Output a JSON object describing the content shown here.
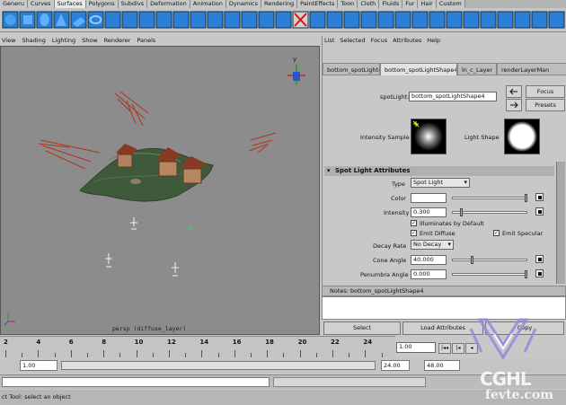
{
  "shelf_tabs": [
    "Generu",
    "Curves",
    "Surfaces",
    "Polygons",
    "Subdivs",
    "Deformation",
    "Animation",
    "Dynamics",
    "Rendering",
    "PaintEffects",
    "Toon",
    "Cloth",
    "Fluids",
    "Fur",
    "Hair",
    "Custom"
  ],
  "shelf_active_index": 2,
  "viewport": {
    "menu": [
      "View",
      "Shading",
      "Lighting",
      "Show",
      "Renderer",
      "Panels"
    ],
    "camera_label": "persp (diffuse_layer)"
  },
  "attribute_editor": {
    "menu": [
      "List",
      "Selected",
      "Focus",
      "Attributes",
      "Help"
    ],
    "tabs": [
      "bottom_spotLight4",
      "bottom_spotLightShape4",
      "ln_c_Layer",
      "renderLayerMan"
    ],
    "active_tab_index": 1,
    "node_label": "spotLight:",
    "node_value": "bottom_spotLightShape4",
    "focus_button": "Focus",
    "presets_button": "Presets",
    "intensity_sample_label": "Intensity Sample",
    "light_shape_label": "Light Shape",
    "section_title": "Spot Light Attributes",
    "type_label": "Type",
    "type_value": "Spot Light",
    "color_label": "Color",
    "intensity_label": "Intensity",
    "intensity_value": "0.300",
    "illuminates_label": "Illuminates by Default",
    "emit_diffuse_label": "Emit Diffuse",
    "emit_specular_label": "Emit Specular",
    "decay_label": "Decay Rate",
    "decay_value": "No Decay",
    "cone_label": "Cone Angle",
    "cone_value": "40.000",
    "penumbra_label": "Penumbra Angle",
    "penumbra_value": "0.000"
  },
  "notes": {
    "title": "Notes: bottom_spotLightShape4"
  },
  "bottom_buttons": {
    "select": "Select",
    "load_attributes": "Load Attributes",
    "copy_tab": "Copy"
  },
  "timeline": {
    "ticks": [
      "2",
      "4",
      "6",
      "8",
      "10",
      "12",
      "14",
      "16",
      "18",
      "20",
      "22",
      "24"
    ],
    "current_frame": "1.00"
  },
  "range": {
    "start": "1.00",
    "end": "24.00",
    "anim_end": "48.00"
  },
  "help_line": "ct Tool: select an object",
  "watermark": {
    "logo": "CGHL",
    "sub": "fevte.com"
  },
  "colors": {
    "viewport_bg": "#8c8c8c",
    "terrain": "#3f5a3a",
    "lights": "#b0341e"
  }
}
